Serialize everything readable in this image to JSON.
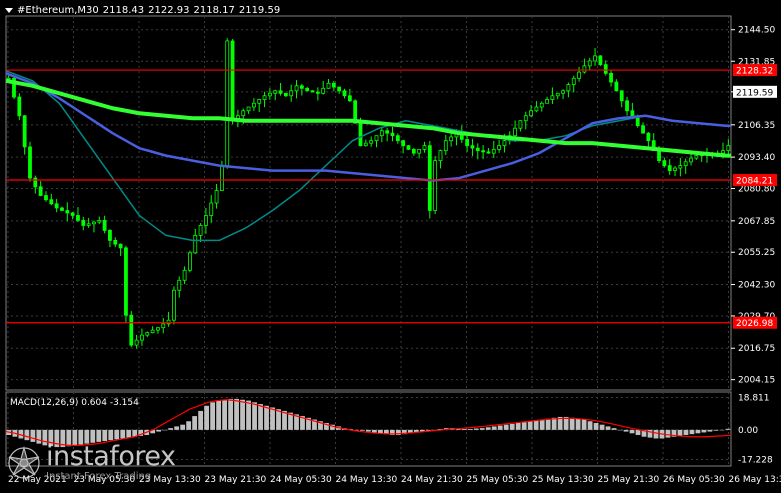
{
  "header": {
    "symbol": "#Ethereum,M30",
    "ohlc": [
      "2118.43",
      "2122.93",
      "2118.17",
      "2119.59"
    ]
  },
  "watermark": {
    "brand": "instaforex",
    "tagline": "Instant Forex Trading"
  },
  "colors": {
    "background": "#000000",
    "grid": "#3c3c3c",
    "candle": "#00ff00",
    "ma_fast": "#008b8b",
    "ma_mid": "#4a5fe0",
    "ma_slow": "#32ff32",
    "level": "#ff0000",
    "macd_hist": "#c0c0c0",
    "macd_signal": "#ff0000"
  },
  "chart_data": [
    {
      "type": "candlestick",
      "ylim": [
        2000,
        2150
      ],
      "y_ticks": [
        2144.5,
        2131.85,
        2119.59,
        2106.35,
        2093.4,
        2080.8,
        2067.85,
        2055.25,
        2042.3,
        2029.7,
        2016.75,
        2004.15
      ],
      "x_ticks": [
        "22 May 2021",
        "23 May 05:30",
        "23 May 13:30",
        "23 May 21:30",
        "24 May 05:30",
        "24 May 13:30",
        "24 May 21:30",
        "25 May 05:30",
        "25 May 13:30",
        "25 May 21:30",
        "26 May 05:30",
        "26 May 13:30"
      ],
      "current_price": "2119.59",
      "levels": [
        {
          "value": 2128.32,
          "label": "2128.32"
        },
        {
          "value": 2084.21,
          "label": "2084.21"
        },
        {
          "value": 2026.98,
          "label": "2026.98"
        }
      ],
      "close_path": [
        [
          0,
          2125
        ],
        [
          2,
          2110
        ],
        [
          4,
          2085
        ],
        [
          6,
          2078
        ],
        [
          9,
          2073
        ],
        [
          12,
          2070
        ],
        [
          14,
          2066
        ],
        [
          17,
          2068
        ],
        [
          19,
          2060
        ],
        [
          21,
          2057
        ],
        [
          22,
          2030
        ],
        [
          23,
          2018
        ],
        [
          25,
          2022
        ],
        [
          28,
          2025
        ],
        [
          30,
          2028
        ],
        [
          31,
          2040
        ],
        [
          33,
          2048
        ],
        [
          35,
          2062
        ],
        [
          37,
          2070
        ],
        [
          39,
          2080
        ],
        [
          40,
          2090
        ],
        [
          41,
          2140
        ],
        [
          42,
          2108
        ],
        [
          44,
          2112
        ],
        [
          46,
          2115
        ],
        [
          48,
          2118
        ],
        [
          50,
          2120
        ],
        [
          52,
          2118
        ],
        [
          54,
          2122
        ],
        [
          56,
          2120
        ],
        [
          58,
          2119
        ],
        [
          60,
          2123
        ],
        [
          62,
          2120
        ],
        [
          64,
          2116
        ],
        [
          66,
          2098
        ],
        [
          68,
          2100
        ],
        [
          70,
          2104
        ],
        [
          72,
          2102
        ],
        [
          74,
          2098
        ],
        [
          76,
          2095
        ],
        [
          78,
          2098
        ],
        [
          79,
          2072
        ],
        [
          80,
          2092
        ],
        [
          82,
          2100
        ],
        [
          84,
          2103
        ],
        [
          86,
          2098
        ],
        [
          88,
          2096
        ],
        [
          90,
          2095
        ],
        [
          92,
          2098
        ],
        [
          94,
          2102
        ],
        [
          96,
          2108
        ],
        [
          98,
          2112
        ],
        [
          100,
          2115
        ],
        [
          102,
          2118
        ],
        [
          104,
          2120
        ],
        [
          106,
          2125
        ],
        [
          108,
          2130
        ],
        [
          110,
          2134
        ],
        [
          112,
          2127
        ],
        [
          114,
          2120
        ],
        [
          116,
          2112
        ],
        [
          118,
          2106
        ],
        [
          120,
          2100
        ],
        [
          122,
          2092
        ],
        [
          124,
          2088
        ],
        [
          126,
          2090
        ],
        [
          128,
          2093
        ],
        [
          130,
          2095
        ],
        [
          132,
          2094
        ],
        [
          134,
          2096
        ],
        [
          135,
          2098
        ],
        [
          136,
          2120
        ]
      ],
      "ma_fast": [
        [
          0,
          2128
        ],
        [
          5,
          2124
        ],
        [
          10,
          2115
        ],
        [
          15,
          2100
        ],
        [
          20,
          2085
        ],
        [
          25,
          2070
        ],
        [
          30,
          2062
        ],
        [
          35,
          2060
        ],
        [
          40,
          2060
        ],
        [
          45,
          2065
        ],
        [
          50,
          2072
        ],
        [
          55,
          2080
        ],
        [
          60,
          2090
        ],
        [
          65,
          2100
        ],
        [
          70,
          2105
        ],
        [
          75,
          2108
        ],
        [
          80,
          2106
        ],
        [
          85,
          2104
        ],
        [
          90,
          2102
        ],
        [
          95,
          2100
        ],
        [
          100,
          2100
        ],
        [
          105,
          2102
        ],
        [
          110,
          2106
        ],
        [
          115,
          2108
        ],
        [
          120,
          2110
        ],
        [
          125,
          2108
        ],
        [
          130,
          2107
        ],
        [
          135,
          2106
        ]
      ],
      "ma_mid": [
        [
          0,
          2127
        ],
        [
          5,
          2123
        ],
        [
          10,
          2117
        ],
        [
          15,
          2110
        ],
        [
          20,
          2103
        ],
        [
          25,
          2097
        ],
        [
          30,
          2094
        ],
        [
          35,
          2092
        ],
        [
          40,
          2090
        ],
        [
          45,
          2089
        ],
        [
          50,
          2088
        ],
        [
          55,
          2088
        ],
        [
          60,
          2088
        ],
        [
          65,
          2087
        ],
        [
          70,
          2086
        ],
        [
          75,
          2085
        ],
        [
          80,
          2084
        ],
        [
          85,
          2085
        ],
        [
          90,
          2088
        ],
        [
          95,
          2091
        ],
        [
          100,
          2095
        ],
        [
          105,
          2101
        ],
        [
          110,
          2107
        ],
        [
          115,
          2109
        ],
        [
          120,
          2110
        ],
        [
          125,
          2108
        ],
        [
          130,
          2107
        ],
        [
          135,
          2106
        ]
      ],
      "ma_slow": [
        [
          0,
          2124
        ],
        [
          5,
          2122
        ],
        [
          10,
          2119
        ],
        [
          15,
          2116
        ],
        [
          20,
          2113
        ],
        [
          25,
          2111
        ],
        [
          30,
          2110
        ],
        [
          35,
          2109
        ],
        [
          40,
          2109
        ],
        [
          45,
          2108
        ],
        [
          50,
          2108
        ],
        [
          55,
          2108
        ],
        [
          60,
          2108
        ],
        [
          65,
          2108
        ],
        [
          70,
          2107
        ],
        [
          75,
          2106
        ],
        [
          80,
          2105
        ],
        [
          85,
          2103
        ],
        [
          90,
          2102
        ],
        [
          95,
          2101
        ],
        [
          100,
          2100
        ],
        [
          105,
          2099
        ],
        [
          110,
          2099
        ],
        [
          115,
          2098
        ],
        [
          120,
          2097
        ],
        [
          125,
          2096
        ],
        [
          130,
          2095
        ],
        [
          135,
          2094
        ]
      ]
    },
    {
      "type": "macd",
      "label": "MACD(12,26,9) 0.604 -3.154",
      "ylim": [
        -21,
        22
      ],
      "y_ticks": [
        18.811,
        0.0,
        -17.228
      ],
      "histogram": [
        -3,
        -4,
        -5,
        -6,
        -7,
        -8,
        -9,
        -9.5,
        -10,
        -10,
        -9.5,
        -9,
        -8.5,
        -8,
        -7.5,
        -7,
        -6.5,
        -6,
        -5.5,
        -5,
        -4.5,
        -4,
        -3.5,
        -3,
        -2,
        -1,
        0,
        1,
        2,
        3,
        5,
        8,
        11,
        14,
        16,
        17,
        17.5,
        18,
        18,
        17.5,
        17,
        16,
        15,
        14,
        13,
        12,
        11,
        10,
        9,
        8,
        7,
        6,
        5,
        4,
        3,
        2,
        1,
        0.5,
        0,
        -0.5,
        -1,
        -1.5,
        -2,
        -2.5,
        -3,
        -3,
        -2.5,
        -2,
        -1.5,
        -1,
        -0.5,
        0,
        0.5,
        1,
        1,
        0.8,
        0.5,
        0.5,
        0.8,
        1,
        1.5,
        2,
        2.5,
        3,
        3.5,
        4,
        4.5,
        5,
        5.5,
        6,
        6.5,
        7,
        7.5,
        7.5,
        7,
        6.5,
        6,
        5,
        4,
        3,
        2,
        1,
        0,
        -1,
        -2,
        -3,
        -4,
        -4.5,
        -5,
        -5,
        -4.5,
        -4,
        -3.5,
        -3,
        -2.5,
        -2,
        -1.5,
        -1,
        -0.5,
        0,
        0.604
      ],
      "signal": [
        -1,
        -2,
        -3.5,
        -5,
        -6.5,
        -7.5,
        -8.5,
        -9,
        -9,
        -8.5,
        -8,
        -7,
        -6,
        -5,
        -4,
        -2,
        0,
        3,
        6,
        9,
        12,
        14,
        16,
        17,
        17.5,
        17,
        16,
        15,
        13.5,
        12,
        10.5,
        9,
        7.5,
        6,
        4.5,
        3,
        1.5,
        0.5,
        -0.5,
        -1.2,
        -1.8,
        -2.2,
        -2.4,
        -2.2,
        -1.8,
        -1.3,
        -0.8,
        -0.3,
        0.2,
        0.6,
        1,
        1.5,
        2,
        2.6,
        3.2,
        3.8,
        4.4,
        5,
        5.6,
        6.1,
        6.5,
        6.7,
        6.6,
        6.2,
        5.5,
        4.6,
        3.5,
        2.3,
        1.1,
        0,
        -1,
        -2,
        -2.8,
        -3.4,
        -3.8,
        -4,
        -4,
        -3.8,
        -3.5,
        -3.154
      ]
    }
  ]
}
